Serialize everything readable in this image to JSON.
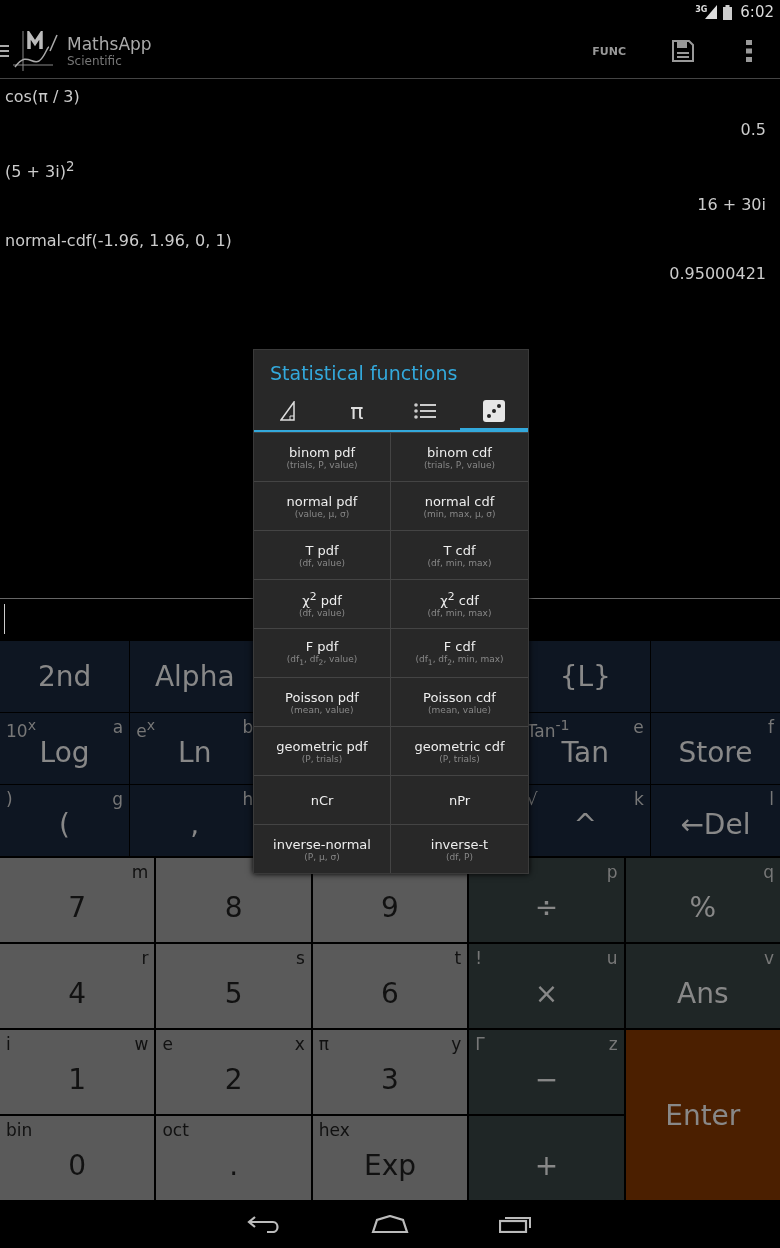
{
  "status_bar": {
    "network": "3G",
    "time": "6:02"
  },
  "action_bar": {
    "title": "MathsApp",
    "subtitle": "Scientific",
    "func_button": "FUNC"
  },
  "history": [
    {
      "expression": "cos(π / 3)",
      "result": "0.5"
    },
    {
      "expression": "(5 + 3i)$^{2}$",
      "result": "16 + 30i"
    },
    {
      "expression": "normal-cdf(-1.96, 1.96, 0, 1)",
      "result": "0.95000421"
    }
  ],
  "function_keys": [
    {
      "kind": "key",
      "label": "2nd"
    },
    {
      "kind": "key",
      "label": "Alpha"
    },
    {
      "kind": "blank"
    },
    {
      "kind": "blank"
    },
    {
      "kind": "key",
      "label": "{L}"
    },
    {
      "kind": "blank"
    },
    {
      "kind": "key",
      "label": "Log",
      "shift": "10$^{x}$",
      "alpha": "a"
    },
    {
      "kind": "key",
      "label": "Ln",
      "shift": "e$^{x}$",
      "alpha": "b"
    },
    {
      "kind": "blank"
    },
    {
      "kind": "blank"
    },
    {
      "kind": "key",
      "label": "Tan",
      "shift": "Tan$^{-1}$",
      "alpha": "e"
    },
    {
      "kind": "key",
      "label": "Store",
      "alpha": "f"
    },
    {
      "kind": "key",
      "label": "(",
      "shift": ")",
      "alpha": "g"
    },
    {
      "kind": "key",
      "label": ",",
      "alpha": "h"
    },
    {
      "kind": "blank"
    },
    {
      "kind": "blank"
    },
    {
      "kind": "key",
      "label": "^",
      "shift": "√",
      "alpha": "k"
    },
    {
      "kind": "key",
      "label": "←Del",
      "alpha": "l"
    }
  ],
  "number_keys": [
    {
      "kind": "digit",
      "label": "7",
      "alpha": "m"
    },
    {
      "kind": "digit",
      "label": "8"
    },
    {
      "kind": "digit",
      "label": "9"
    },
    {
      "kind": "op",
      "label": "÷",
      "alpha": "p"
    },
    {
      "kind": "op",
      "label": "%",
      "alpha": "q"
    },
    {
      "kind": "digit",
      "label": "4",
      "alpha": "r"
    },
    {
      "kind": "digit",
      "label": "5",
      "alpha": "s"
    },
    {
      "kind": "digit",
      "label": "6",
      "alpha": "t"
    },
    {
      "kind": "op",
      "label": "×",
      "shift": "!",
      "alpha": "u"
    },
    {
      "kind": "op",
      "label": "Ans",
      "alpha": "v"
    },
    {
      "kind": "digit",
      "label": "1",
      "shift": "i",
      "alpha": "w"
    },
    {
      "kind": "digit",
      "label": "2",
      "shift": "e",
      "alpha": "x"
    },
    {
      "kind": "digit",
      "label": "3",
      "shift": "π",
      "alpha": "y"
    },
    {
      "kind": "op",
      "label": "−",
      "shift": "Γ",
      "alpha": "z"
    },
    {
      "kind": "enter",
      "label": "Enter"
    },
    {
      "kind": "digit",
      "label": "0",
      "shift": "bin"
    },
    {
      "kind": "digit",
      "label": ".",
      "shift": "oct"
    },
    {
      "kind": "digit",
      "label": "Exp",
      "shift": "hex"
    },
    {
      "kind": "op",
      "label": "+"
    }
  ],
  "popup": {
    "title": "Statistical functions",
    "tabs": [
      {
        "kind": "triangle",
        "selected": false
      },
      {
        "kind": "text",
        "label": "π",
        "selected": false
      },
      {
        "kind": "list",
        "selected": false
      },
      {
        "kind": "dice",
        "selected": true
      }
    ],
    "functions": [
      {
        "name": "binom pdf",
        "args": "(trials, P, value)"
      },
      {
        "name": "binom cdf",
        "args": "(trials, P, value)"
      },
      {
        "name": "normal pdf",
        "args": "(value, μ, σ)"
      },
      {
        "name": "normal cdf",
        "args": "(min, max, μ, σ)"
      },
      {
        "name": "T pdf",
        "args": "(df, value)"
      },
      {
        "name": "T cdf",
        "args": "(df, min, max)"
      },
      {
        "name": "χ$^{2}$ pdf",
        "args": "(df, value)"
      },
      {
        "name": "χ$^{2}$ cdf",
        "args": "(df, min, max)"
      },
      {
        "name": "F pdf",
        "args": "(df$_{1}$, df$_{2}$, value)"
      },
      {
        "name": "F cdf",
        "args": "(df$_{1}$, df$_{2}$, min, max)"
      },
      {
        "name": "Poisson pdf",
        "args": "(mean, value)"
      },
      {
        "name": "Poisson cdf",
        "args": "(mean, value)"
      },
      {
        "name": "geometric pdf",
        "args": "(P, trials)"
      },
      {
        "name": "geometric cdf",
        "args": "(P, trials)"
      },
      {
        "name": "nCr"
      },
      {
        "name": "nPr"
      },
      {
        "name": "inverse-normal",
        "args": "(P, μ, σ)"
      },
      {
        "name": "inverse-t",
        "args": "(df, P)"
      }
    ]
  }
}
